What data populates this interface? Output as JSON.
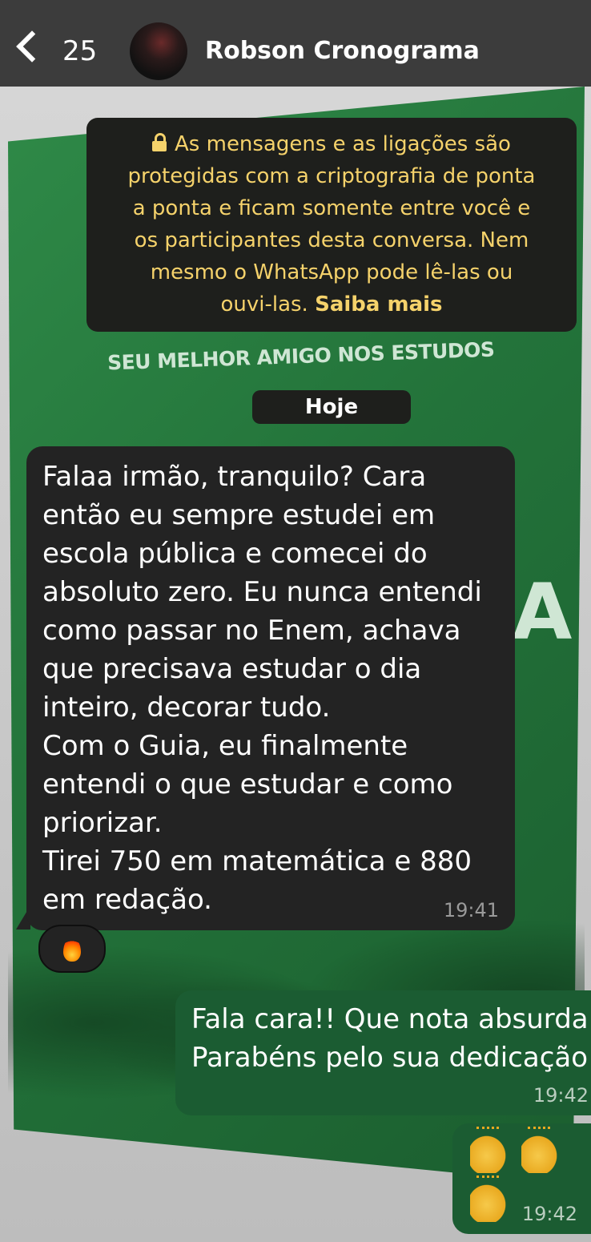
{
  "header": {
    "back_count": "25",
    "contact_name": "Robson Cronograma"
  },
  "wallpaper": {
    "tagline": "SEU MELHOR AMIGO NOS ESTUDOS",
    "letter": "A"
  },
  "notice": {
    "line1": "As mensagens e as ligações são",
    "line2": "protegidas com a criptografia de ponta",
    "line3": "a ponta e ficam somente entre você e",
    "line4": "os participantes desta conversa. Nem",
    "line5": "mesmo o WhatsApp pode lê-las ou",
    "line6": "ouvi-las.",
    "link": "Saiba mais"
  },
  "date_chip": "Hoje",
  "messages": {
    "incoming": {
      "lines": [
        "Falaa irmão, tranquilo? Cara",
        "então eu sempre estudei em",
        "escola pública e comecei do",
        "absoluto zero. Eu nunca entendi",
        "como passar no Enem, achava",
        "que precisava estudar o dia",
        "inteiro, decorar tudo.",
        "Com o Guia, eu finalmente",
        "entendi o que estudar e como",
        "priorizar.",
        "Tirei 750 em matemática e 880",
        "em redação."
      ],
      "time": "19:41",
      "reaction": "fire-icon"
    },
    "outgoing": {
      "lines": [
        "Fala cara!! Que nota absurda",
        "Parabéns pelo sua dedicação"
      ],
      "time": "19:42"
    },
    "outgoing2": {
      "emoji": "clap-icon",
      "time": "19:42"
    }
  }
}
